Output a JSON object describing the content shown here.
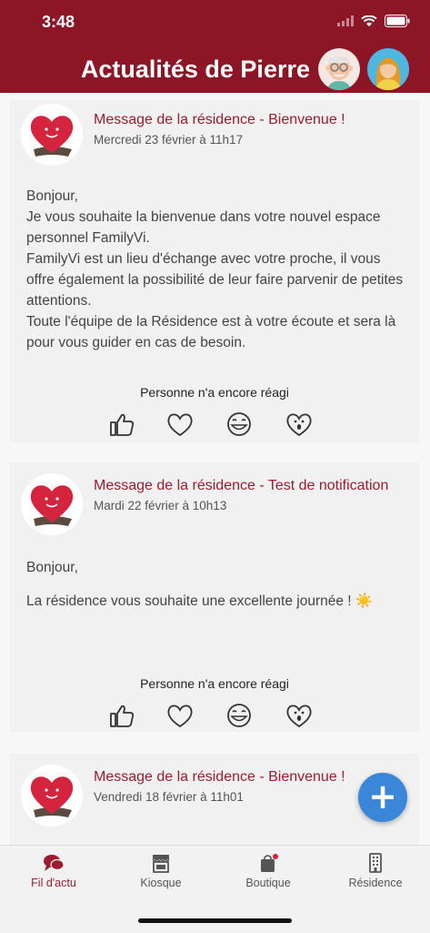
{
  "status_bar": {
    "time": "3:48"
  },
  "header": {
    "title": "Actualités de Pierre"
  },
  "posts": [
    {
      "title": "Message de la résidence - Bienvenue !",
      "date": "Mercredi 23 février à 11h17",
      "body": [
        "Bonjour,",
        "Je vous souhaite la bienvenue dans votre nouvel espace personnel FamilyVi.",
        "FamilyVi est un lieu d'échange avec votre proche, il vous offre également la possibilité de leur faire parvenir de petites attentions.",
        "Toute l'équipe de la Résidence est à votre écoute et sera là pour vous guider en cas de besoin."
      ],
      "reactions_text": "Personne n'a encore réagi"
    },
    {
      "title": "Message de la résidence - Test de notification",
      "date": "Mardi 22 février à 10h13",
      "body": [
        "Bonjour,",
        "La résidence vous souhaite une excellente journée ! ☀️"
      ],
      "reactions_text": "Personne n'a encore réagi"
    },
    {
      "title": "Message de la résidence - Bienvenue !",
      "date": "Vendredi 18 février à 11h01"
    }
  ],
  "reactions": [
    "thumbs-up-icon",
    "heart-icon",
    "laugh-icon",
    "wow-icon"
  ],
  "tabs": [
    {
      "label": "Fil d'actu",
      "icon": "chat-bubbles-icon",
      "active": true
    },
    {
      "label": "Kiosque",
      "icon": "store-icon",
      "active": false
    },
    {
      "label": "Boutique",
      "icon": "shopping-bag-icon",
      "active": false
    },
    {
      "label": "Résidence",
      "icon": "building-icon",
      "active": false
    }
  ],
  "colors": {
    "brand": "#8c1526",
    "title": "#9c1c2e",
    "fab": "#3a86d8"
  }
}
